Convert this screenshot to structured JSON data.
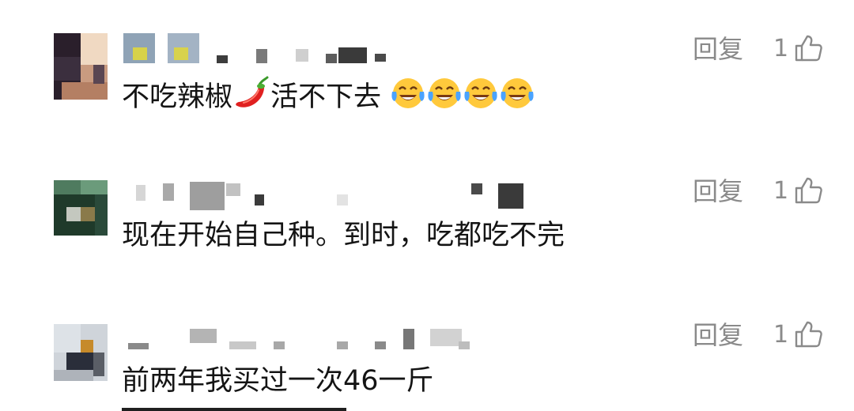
{
  "comments": [
    {
      "text": "不吃辣椒",
      "text_after": "活不下去",
      "emojis": [
        "chili-pepper",
        "tears-of-joy",
        "tears-of-joy",
        "tears-of-joy",
        "tears-of-joy"
      ],
      "reply_label": "回复",
      "like_count": "1"
    },
    {
      "text": "现在开始自己种。到时，吃都吃不完",
      "reply_label": "回复",
      "like_count": "1"
    },
    {
      "text": "前两年我买过一次46一斤",
      "reply_label": "回复",
      "like_count": "1"
    }
  ],
  "colors": {
    "text": "#141414",
    "meta": "#8a8a8a"
  }
}
